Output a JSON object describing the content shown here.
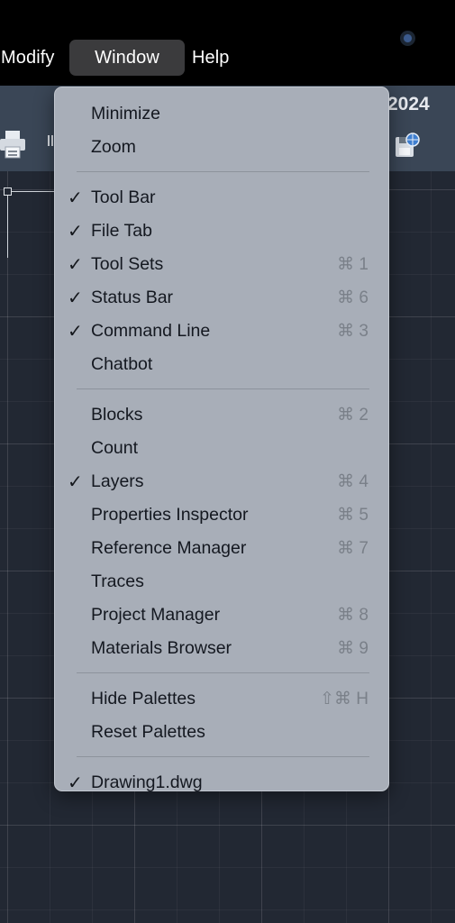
{
  "menubar": {
    "items": [
      {
        "label": "Modify"
      },
      {
        "label": "Window"
      },
      {
        "label": "Help"
      }
    ]
  },
  "app": {
    "year": "2024"
  },
  "window_menu": {
    "sections": [
      [
        {
          "label": "Minimize",
          "checked": false,
          "shortcut": ""
        },
        {
          "label": "Zoom",
          "checked": false,
          "shortcut": ""
        }
      ],
      [
        {
          "label": "Tool Bar",
          "checked": true,
          "shortcut": ""
        },
        {
          "label": "File Tab",
          "checked": true,
          "shortcut": ""
        },
        {
          "label": "Tool Sets",
          "checked": true,
          "shortcut": "⌘ 1"
        },
        {
          "label": "Status Bar",
          "checked": true,
          "shortcut": "⌘ 6"
        },
        {
          "label": "Command Line",
          "checked": true,
          "shortcut": "⌘ 3"
        },
        {
          "label": "Chatbot",
          "checked": false,
          "shortcut": ""
        }
      ],
      [
        {
          "label": "Blocks",
          "checked": false,
          "shortcut": "⌘ 2"
        },
        {
          "label": "Count",
          "checked": false,
          "shortcut": ""
        },
        {
          "label": "Layers",
          "checked": true,
          "shortcut": "⌘ 4"
        },
        {
          "label": "Properties Inspector",
          "checked": false,
          "shortcut": "⌘ 5"
        },
        {
          "label": "Reference Manager",
          "checked": false,
          "shortcut": "⌘ 7"
        },
        {
          "label": "Traces",
          "checked": false,
          "shortcut": ""
        },
        {
          "label": "Project Manager",
          "checked": false,
          "shortcut": "⌘ 8"
        },
        {
          "label": "Materials Browser",
          "checked": false,
          "shortcut": "⌘ 9"
        }
      ],
      [
        {
          "label": "Hide Palettes",
          "checked": false,
          "shortcut": "⇧⌘ H"
        },
        {
          "label": "Reset Palettes",
          "checked": false,
          "shortcut": ""
        }
      ],
      [
        {
          "label": "Drawing1.dwg",
          "checked": true,
          "shortcut": ""
        }
      ]
    ],
    "check_glyph": "✓"
  },
  "icons": {
    "print": "printer-icon",
    "save": "save-icon",
    "status": "status-indicator-icon"
  },
  "colors": {
    "menu_bg": "#a8aeb8",
    "menubar_bg": "#000000",
    "toolbar_bg": "#3a4656",
    "canvas_bg": "#222833"
  }
}
